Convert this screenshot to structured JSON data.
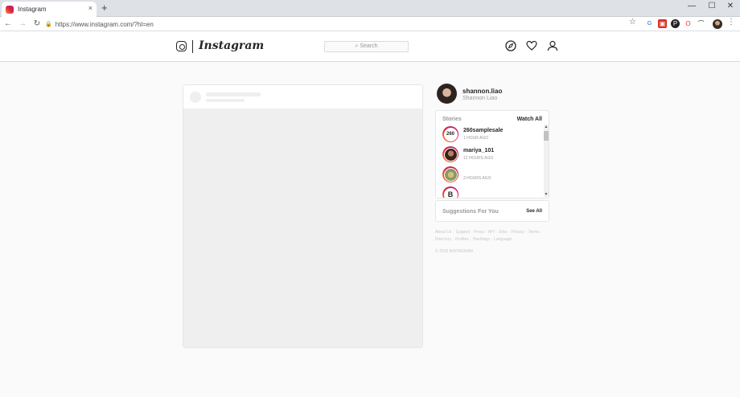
{
  "browser": {
    "tab_title": "Instagram",
    "tab_close": "×",
    "new_tab": "+",
    "url": "https://www.instagram.com/?hl=en",
    "win_min": "—",
    "win_max": "☐",
    "win_close": "✕"
  },
  "nav": {
    "wordmark": "Instagram",
    "search_placeholder": "Search"
  },
  "profile": {
    "username": "shannon.liao",
    "full_name": "Shannon Liao"
  },
  "stories": {
    "title": "Stories",
    "watch_all": "Watch All",
    "items": [
      {
        "badge": "260",
        "user": "260samplesale",
        "time": "1 HOUR AGO"
      },
      {
        "badge": "",
        "user": "mariya_101",
        "time": "12 HOURS AGO"
      },
      {
        "badge": "",
        "user": "",
        "time": "3 HOURS AGO"
      },
      {
        "badge": "B",
        "user": "",
        "time": ""
      }
    ]
  },
  "suggestions": {
    "title": "Suggestions For You",
    "see_all": "See All"
  },
  "footer": {
    "links": [
      "About Us",
      "Support",
      "Press",
      "API",
      "Jobs",
      "Privacy",
      "Terms",
      "Directory",
      "Profiles",
      "Hashtags",
      "Language"
    ],
    "copyright": "© 2019 INSTAGRAM"
  }
}
